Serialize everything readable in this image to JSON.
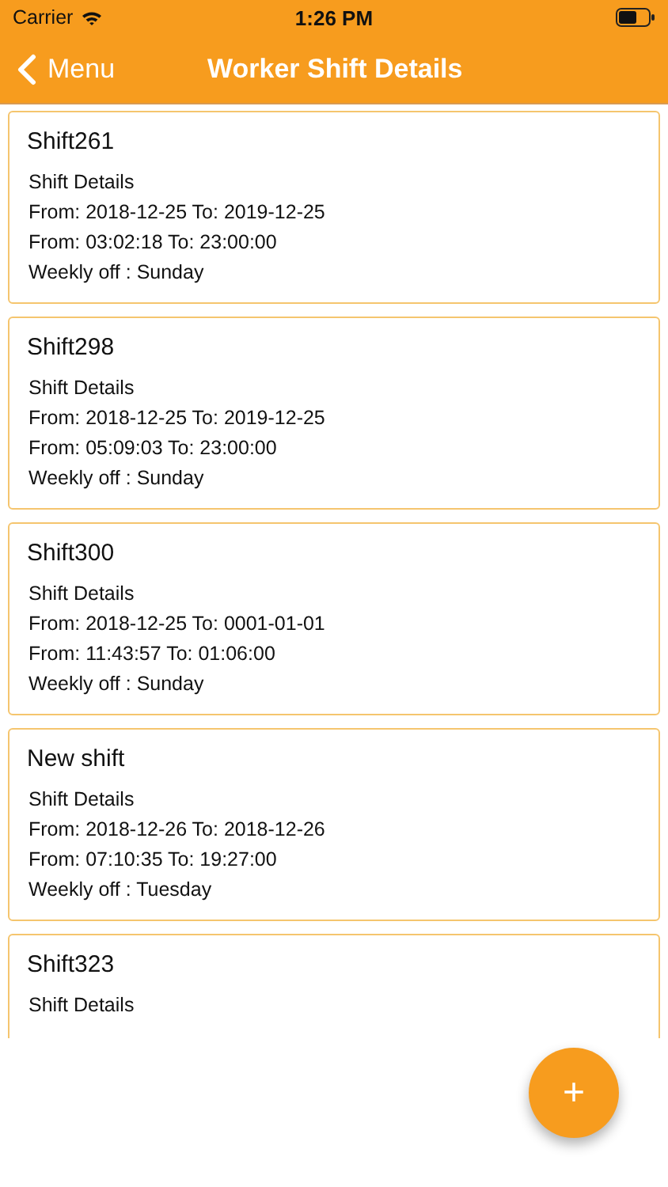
{
  "status_bar": {
    "carrier": "Carrier",
    "time": "1:26 PM"
  },
  "nav": {
    "back": "Menu",
    "title": "Worker Shift Details"
  },
  "shifts": [
    {
      "name": "Shift261",
      "lines": [
        "Shift Details",
        "From: 2018-12-25 To: 2019-12-25",
        "From: 03:02:18 To: 23:00:00",
        "Weekly off : Sunday"
      ]
    },
    {
      "name": "Shift298",
      "lines": [
        "Shift Details",
        "From: 2018-12-25 To: 2019-12-25",
        "From: 05:09:03 To: 23:00:00",
        "Weekly off : Sunday"
      ]
    },
    {
      "name": "Shift300",
      "lines": [
        "Shift Details",
        "From: 2018-12-25 To: 0001-01-01",
        "From: 11:43:57 To: 01:06:00",
        "Weekly off : Sunday"
      ]
    },
    {
      "name": "New shift",
      "lines": [
        "Shift Details",
        "From: 2018-12-26 To: 2018-12-26",
        "From: 07:10:35 To: 19:27:00",
        "Weekly off : Tuesday"
      ]
    },
    {
      "name": "Shift323",
      "lines": [
        "Shift Details"
      ]
    }
  ],
  "fab": {
    "label": "+"
  }
}
